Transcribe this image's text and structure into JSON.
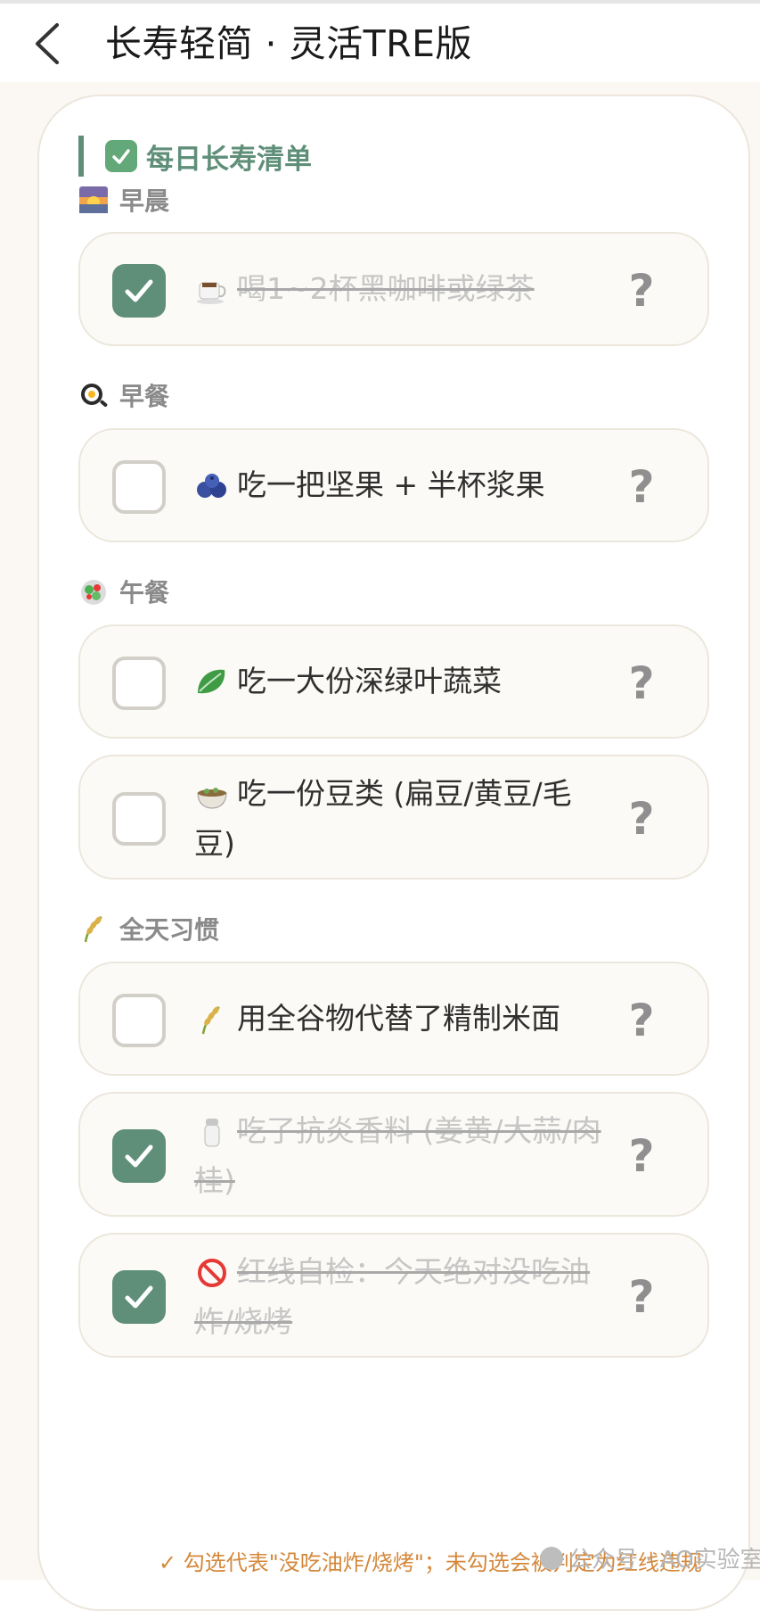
{
  "header": {
    "title": "长寿轻简 · 灵活TRE版"
  },
  "checklist": {
    "title": "每日长寿清单"
  },
  "groups": [
    {
      "label": "早晨",
      "icon": "sunrise-icon"
    },
    {
      "label": "早餐",
      "icon": "fried-egg-icon"
    },
    {
      "label": "午餐",
      "icon": "salad-icon"
    },
    {
      "label": "全天习惯",
      "icon": "rice-stalk-icon"
    }
  ],
  "items": [
    {
      "text": "喝1~2杯黑咖啡或绿茶",
      "icon": "coffee-icon",
      "checked": true
    },
    {
      "text": "吃一把坚果 + 半杯浆果",
      "icon": "blueberries-icon",
      "checked": false
    },
    {
      "text": "吃一大份深绿叶蔬菜",
      "icon": "leafy-green-icon",
      "checked": false
    },
    {
      "text": "吃一份豆类 (扁豆/黄豆/毛豆)",
      "icon": "bowl-icon",
      "checked": false
    },
    {
      "text": "用全谷物代替了精制米面",
      "icon": "rice-stalk-icon",
      "checked": false
    },
    {
      "text": "吃了抗炎香料 (姜黄/大蒜/肉桂)",
      "icon": "salt-shaker-icon",
      "checked": true
    },
    {
      "text": "红线自检：今天绝对没吃油炸/烧烤",
      "icon": "prohibited-icon",
      "checked": true
    }
  ],
  "help_label": "?",
  "footer": {
    "note": "✓ 勾选代表\"没吃油炸/烧烤\"；未勾选会被判定为红线违规",
    "watermark": "公众号 · AO实验室"
  },
  "colors": {
    "accent": "#5f8f79",
    "note": "#d4883b"
  }
}
